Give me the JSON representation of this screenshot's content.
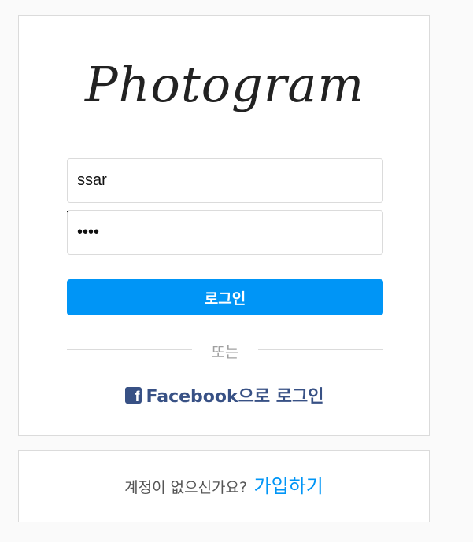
{
  "app": {
    "logo_text": "Photogram"
  },
  "login_form": {
    "username_value": "ssar",
    "password_value": "1234",
    "login_button_label": "로그인",
    "divider_text": "또는",
    "facebook_icon_glyph": "f",
    "facebook_login_label": "Facebook으로 로그인"
  },
  "signup": {
    "prompt": "계정이 없으신가요?",
    "link_label": "가입하기"
  },
  "colors": {
    "primary_blue": "#0095f6",
    "facebook_blue": "#385185",
    "border": "#dbdbdb",
    "background": "#fafafa"
  },
  "icons": {
    "facebook": "facebook-square-icon"
  }
}
